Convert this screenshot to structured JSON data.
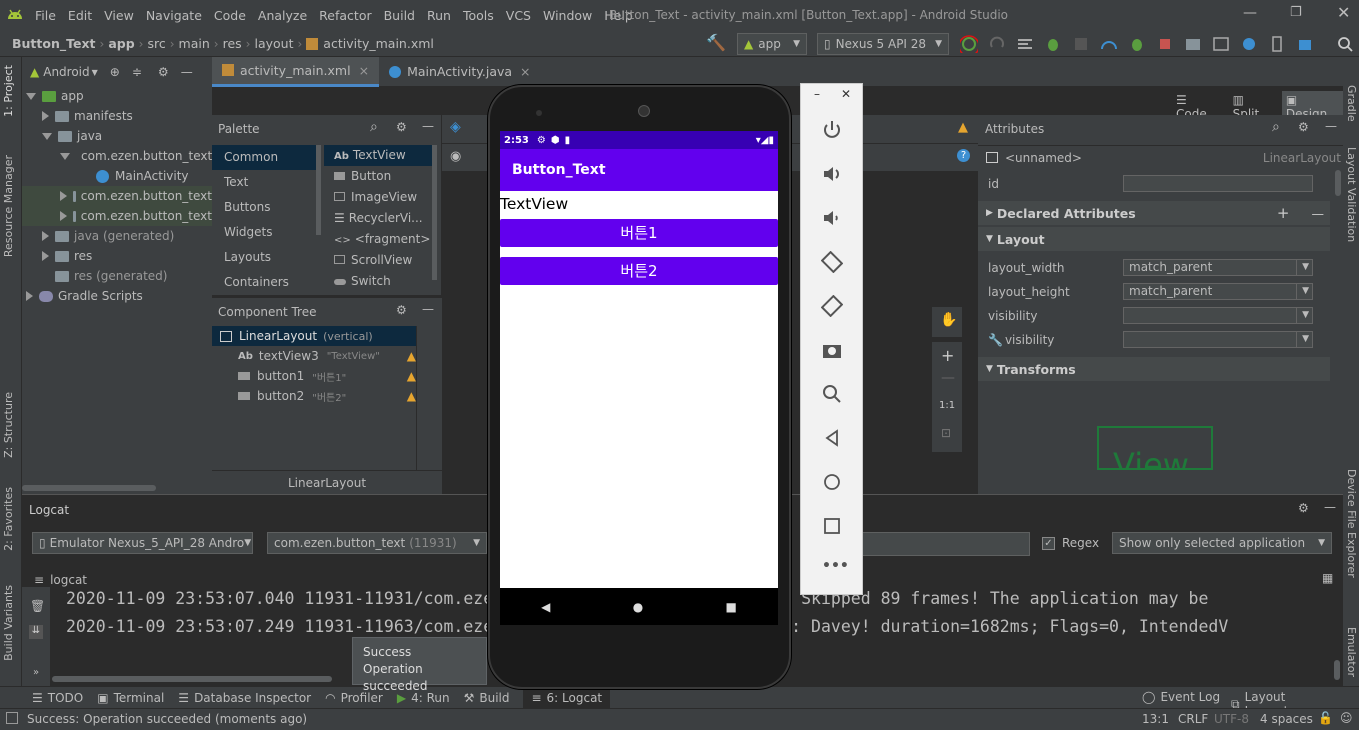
{
  "titlebar": {
    "menu": [
      "File",
      "Edit",
      "View",
      "Navigate",
      "Code",
      "Analyze",
      "Refactor",
      "Build",
      "Run",
      "Tools",
      "VCS",
      "Window",
      "Help"
    ],
    "title": "Button_Text - activity_main.xml [Button_Text.app] - Android Studio"
  },
  "breadcrumb": [
    "Button_Text",
    "app",
    "src",
    "main",
    "res",
    "layout",
    "activity_main.xml"
  ],
  "toolbar": {
    "module": "app",
    "device": "Nexus 5 API 28"
  },
  "project": {
    "view": "Android",
    "items": [
      "app",
      "manifests",
      "java",
      "com.ezen.button_text",
      "MainActivity",
      "com.ezen.button_text",
      "com.ezen.button_text",
      "java (generated)",
      "res",
      "res (generated)",
      "Gradle Scripts"
    ]
  },
  "tabs": [
    "activity_main.xml",
    "MainActivity.java"
  ],
  "viewmodes": [
    "Code",
    "Split",
    "Design"
  ],
  "palette": {
    "title": "Palette",
    "categories": [
      "Common",
      "Text",
      "Buttons",
      "Widgets",
      "Layouts",
      "Containers"
    ],
    "widgets": [
      "TextView",
      "Button",
      "ImageView",
      "RecyclerVi...",
      "<fragment>",
      "ScrollView",
      "Switch"
    ]
  },
  "component_tree": {
    "title": "Component Tree",
    "root": "LinearLayout",
    "root_hint": "(vertical)",
    "children": [
      {
        "type": "Ab",
        "name": "textView3",
        "text": "\"TextView\""
      },
      {
        "name": "button1",
        "text": "\"버튼1\""
      },
      {
        "name": "button2",
        "text": "\"버튼2\""
      }
    ],
    "footer": "LinearLayout"
  },
  "attributes": {
    "title": "Attributes",
    "component": "<unnamed>",
    "layout": "LinearLayout",
    "id_label": "id",
    "declared": "Declared Attributes",
    "layout_section": "Layout",
    "layout_width": "layout_width",
    "layout_width_val": "match_parent",
    "layout_height": "layout_height",
    "layout_height_val": "match_parent",
    "visibility": "visibility",
    "visibility2": "visibility",
    "transforms": "Transforms",
    "preview": "View"
  },
  "phone": {
    "time": "2:53",
    "app_title": "Button_Text",
    "textview": "TextView",
    "button1": "버튼1",
    "button2": "버튼2",
    "accent": "#6200ee",
    "statusbar": "#3700b3"
  },
  "logcat": {
    "title": "Logcat",
    "device": "Emulator Nexus_5_API_28 Andro",
    "package": "com.ezen.button_text",
    "pid": "(11931)",
    "regex": "Regex",
    "filter": "Show only selected application",
    "sub": "logcat",
    "lines": [
      "2020-11-09 23:53:07.040 11931-11931/com.ezen.button_text I/Choreographer: Skipped 89 frames!  The application may be",
      "2020-11-09 23:53:07.249 11931-11963/com.ezen.button_text I/OpenGLRenderer: Davey! duration=1682ms; Flags=0, IntendedV"
    ]
  },
  "toast": {
    "title": "Success",
    "body": "Operation succeeded"
  },
  "bottom_tabs": [
    "TODO",
    "Terminal",
    "Database Inspector",
    "Profiler",
    "4: Run",
    "Build",
    "6: Logcat"
  ],
  "bottom_right": [
    "Event Log",
    "Layout Inspector"
  ],
  "status": {
    "message": "Success: Operation succeeded (moments ago)",
    "pos": "13:1",
    "crlf": "CRLF",
    "enc": "UTF-8",
    "indent": "4 spaces"
  },
  "left_strip": [
    "1: Project",
    "Resource Manager",
    "Z: Structure",
    "2: Favorites",
    "Build Variants"
  ],
  "right_strip": [
    "Gradle",
    "Layout Validation",
    "Device File Explorer",
    "Emulator"
  ]
}
